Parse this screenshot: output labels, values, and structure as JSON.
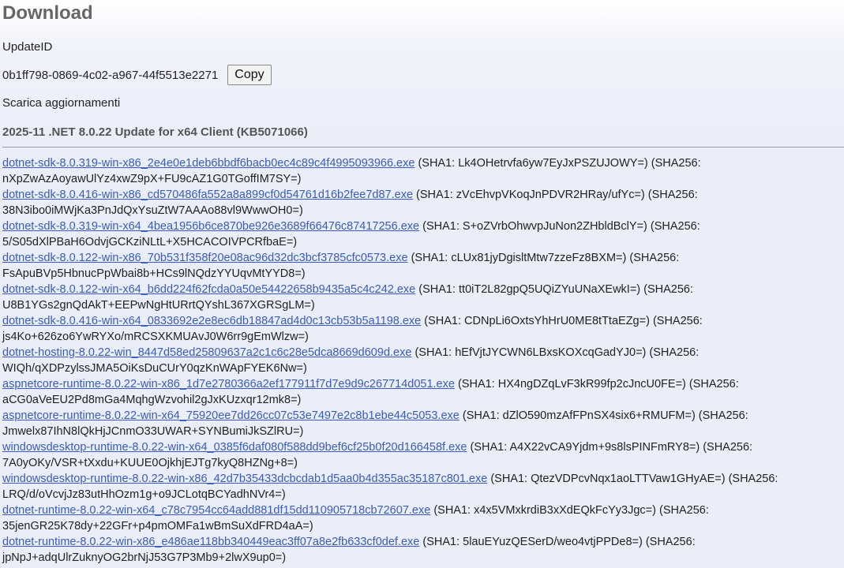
{
  "page": {
    "title": "Download",
    "update_id_label": "UpdateID",
    "update_id": "0b1ff798-0869-4c02-a967-44f5513e2271",
    "copy_label": "Copy",
    "download_label": "Scarica aggiornamenti",
    "update_title": "2025-11 .NET 8.0.22 Update for x64 Client (KB5071066)"
  },
  "files": [
    {
      "name": "dotnet-sdk-8.0.319-win-x86_2e4e0e1deb6bbdf6bacb0ec4c89c4f4995093966.exe",
      "hashes": "(SHA1: Lk4OHetrvfa6yw7EyJxPSZUJOWY=) (SHA256: nXpZwAzAoyawUlYz4xwZ9pX+FU9cAZ1G0TGoffIM7SY=)"
    },
    {
      "name": "dotnet-sdk-8.0.416-win-x86_cd570486fa552a8a899cf0d54761d16b2fee7d87.exe",
      "hashes": "(SHA1: zVcEhvpVKoqJnPDVR2HRay/ufYc=) (SHA256: 38N3ibo0iMWjKa3PnJdQxYsuZtW7AAAo88vl9WwwOH0=)"
    },
    {
      "name": "dotnet-sdk-8.0.319-win-x64_4bea1956b6ce870be926e3689f66476c87417256.exe",
      "hashes": "(SHA1: S+oZVrbOhwvpJuNon2ZHbldBclY=) (SHA256: 5/S05dXlPBaH6OdvjGCKziNLtL+X5HCACOIVPCRfbaE=)"
    },
    {
      "name": "dotnet-sdk-8.0.122-win-x86_70b531f358f20e08ac96d32dc3bcf3785cfc0573.exe",
      "hashes": "(SHA1: cLUx81jyDgisltMtw7zzeFz8BXM=) (SHA256: FsApuBVp5HbnucPpWbai8b+HCs9lNQdzYYUqvMtYYD8=)"
    },
    {
      "name": "dotnet-sdk-8.0.122-win-x64_b6dd224f62fcda0a50e54422658b9435a5c4c242.exe",
      "hashes": "(SHA1: tt0iT2L82gpQ5UQiZYuUNaXEwkI=) (SHA256: U8B1YGs2gnQdAkT+EEPwNgHtURrtQYshL367XGRSgLM=)"
    },
    {
      "name": "dotnet-sdk-8.0.416-win-x64_0833692e2e8ec6db18847ad4d0c13cb53b5a1198.exe",
      "hashes": "(SHA1: CDNpLi6OxtsYhHrU0ME8tTtaEZg=) (SHA256: js4Ko+626zo6YwRYXo/mRCSXKMUAvJ0W6rr9gEmWlzw=)"
    },
    {
      "name": "dotnet-hosting-8.0.22-win_8447d58ed25809637a2c1c6c28e5dca8669d609d.exe",
      "hashes": "(SHA1: hEfVjtJYCWN6LBxsKOXcqGadYJ0=) (SHA256: WIQh/qXDPzylssJMA5OiKsDuCUrY0qzKnWApFYEK6Nw=)"
    },
    {
      "name": "aspnetcore-runtime-8.0.22-win-x86_1d7e2780366a2ef177911f7d7e9d9c267714d051.exe",
      "hashes": "(SHA1: HX4ngDZqLvF3kR99fp2cJncU0FE=) (SHA256: aCG0aVeEU2Pd8mGa4MqhgWzvohil2gJxKUzxqr12mk8=)"
    },
    {
      "name": "aspnetcore-runtime-8.0.22-win-x64_75920ee7dd26cc07c53e7497e2c8b1ebe44c5053.exe",
      "hashes": "(SHA1: dZlO590mzAfFPnSX4six6+RMUFM=) (SHA256: Jmwelx87IhN8lQkHjJCnmO33UWAR+SYNBumiJkSZlRU=)"
    },
    {
      "name": "windowsdesktop-runtime-8.0.22-win-x64_0385f6daf080f588dd9bef6cf25b0f20d166458f.exe",
      "hashes": "(SHA1: A4X22vCA9Yjdm+9s8lsPINFmRY8=) (SHA256: 7A0yOKy/VSR+tXxdu+KUUE0OjkhjEJTg7kyQ8HZNg+8=)"
    },
    {
      "name": "windowsdesktop-runtime-8.0.22-win-x86_42d7b35433dcbcdab1d5aa0b4d355ac35187c801.exe",
      "hashes": "(SHA1: QtezVDPcvNqx1aoLTTVaw1GHyAE=) (SHA256: LRQ/d/oVcvjJz83utHhOzm1g+o9JCLotqBCYadhNVr4=)"
    },
    {
      "name": "dotnet-runtime-8.0.22-win-x64_c78c7954cc64add881df15dd110905718cb72607.exe",
      "hashes": "(SHA1: x4x5VMxkrdiB3xXdEQkFcYy3Jgc=) (SHA256: 35jenGR25K78dy+22GFr+p4pmOMFa1wBmSuXdFRD4aA=)"
    },
    {
      "name": "dotnet-runtime-8.0.22-win-x86_e486ae118bb340449eac3ff07a8e2fb633cf0def.exe",
      "hashes": "(SHA1: 5lauEYuzQESerD/weo4vtjPPDe8=) (SHA256: jpNpJ+adqUlrZuknyOG2brNjJ53G7P3Mb9+2lwX9up0=)"
    }
  ]
}
